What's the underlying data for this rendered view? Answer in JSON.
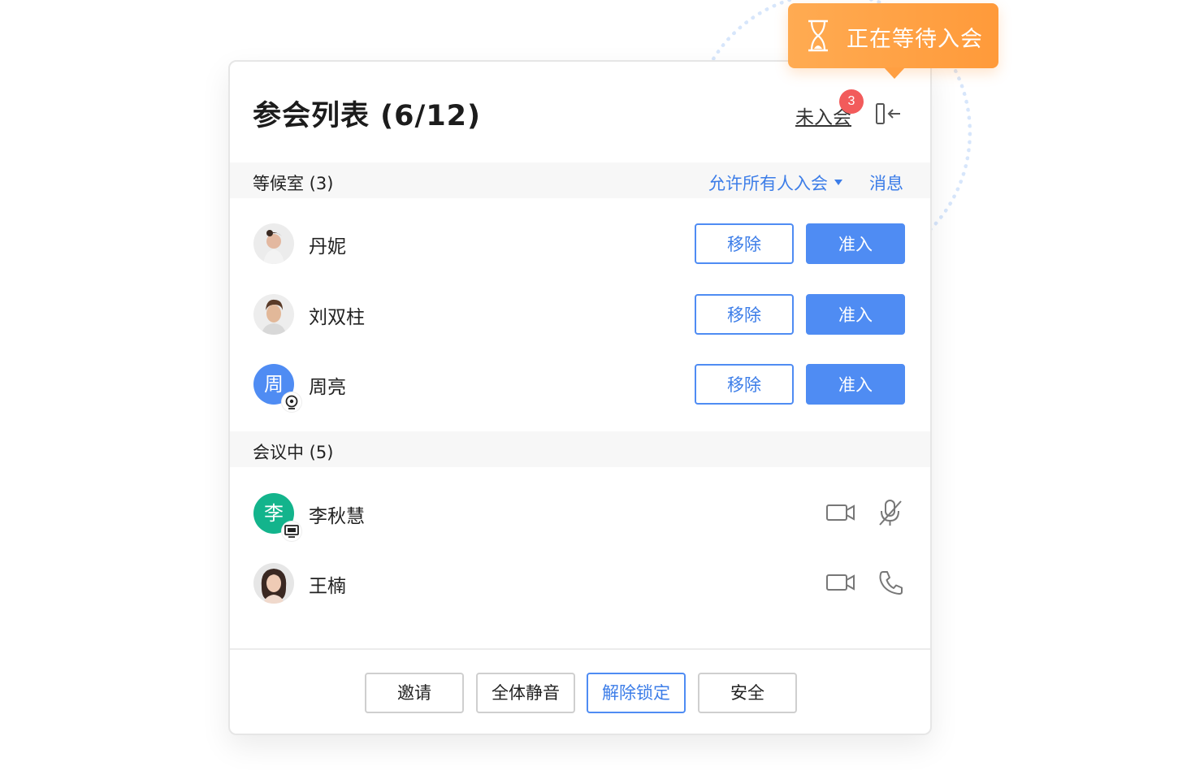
{
  "tooltip": {
    "text": "正在等待入会",
    "icon": "hourglass-icon"
  },
  "header": {
    "title": "参会列表 (6/12)",
    "not_joined_label": "未入会",
    "not_joined_count": "3",
    "collapse_icon": "collapse-panel-icon"
  },
  "waiting_room": {
    "label": "等候室 (3)",
    "allow_all_label": "允许所有人入会",
    "message_label": "消息",
    "members": [
      {
        "name": "丹妮",
        "avatar": "photo",
        "remove_label": "移除",
        "admit_label": "准入"
      },
      {
        "name": "刘双柱",
        "avatar": "photo",
        "remove_label": "移除",
        "admit_label": "准入"
      },
      {
        "name": "周亮",
        "avatar_letter": "周",
        "avatar_color": "#4f8cf3",
        "badge_icon": "webcam-icon",
        "remove_label": "移除",
        "admit_label": "准入"
      }
    ]
  },
  "in_meeting": {
    "label": "会议中 (5)",
    "members": [
      {
        "name": "李秋慧",
        "avatar_letter": "李",
        "avatar_color": "#13b48c",
        "badge_icon": "screen-share-icon",
        "video_icon": "video-camera-icon",
        "audio_icon": "microphone-muted-icon"
      },
      {
        "name": "王楠",
        "avatar": "photo",
        "video_icon": "video-camera-icon",
        "audio_icon": "phone-icon"
      }
    ]
  },
  "footer": {
    "invite_label": "邀请",
    "mute_all_label": "全体静音",
    "unlock_label": "解除锁定",
    "security_label": "安全"
  },
  "colors": {
    "accent": "#4f8cf3",
    "tooltip": "#ffa047",
    "badge": "#f25b5b",
    "green_avatar": "#13b48c"
  }
}
